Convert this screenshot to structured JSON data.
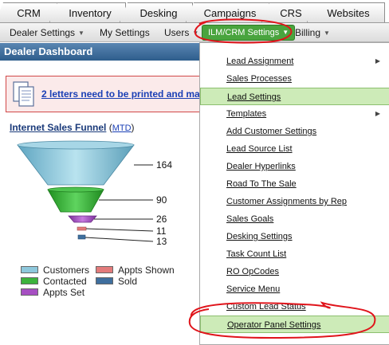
{
  "tabs": [
    {
      "label": "CRM"
    },
    {
      "label": "Inventory"
    },
    {
      "label": "Desking"
    },
    {
      "label": "Campaigns"
    },
    {
      "label": "CRS"
    },
    {
      "label": "Websites"
    }
  ],
  "subnav": {
    "dealer_settings": "Dealer Settings",
    "my_settings": "My Settings",
    "users": "Users",
    "ilm_crm_settings": "ILM/CRM Settings",
    "billing": "Billing"
  },
  "dashboard": {
    "title": "Dealer Dashboard",
    "alert_link": "2 letters need to be printed and mai"
  },
  "funnel": {
    "title": "Internet Sales Funnel",
    "period": "MTD",
    "values": {
      "customers": "164",
      "contacted": "90",
      "appts_set": "26",
      "appts_shown": "11",
      "sold": "13"
    },
    "colors": {
      "customers": "#8ec8dc",
      "contacted": "#3cb33c",
      "appts_set": "#a64fc2",
      "appts_shown": "#e37b7b",
      "sold": "#3f6f9e"
    }
  },
  "legend": {
    "customers": "Customers",
    "contacted": "Contacted",
    "appts_set": "Appts Set",
    "appts_shown": "Appts Shown",
    "sold": "Sold"
  },
  "menu": {
    "items": [
      {
        "label": "Lead Assignment",
        "has_submenu": true
      },
      {
        "label": "Sales Processes"
      },
      {
        "label": "Lead Settings",
        "highlighted": true
      },
      {
        "label": "Templates",
        "has_submenu": true
      },
      {
        "label": "Add Customer Settings"
      },
      {
        "label": "Lead Source List"
      },
      {
        "label": "Dealer Hyperlinks"
      },
      {
        "label": "Road To The Sale"
      },
      {
        "label": "Customer Assignments by Rep"
      },
      {
        "label": "Sales Goals"
      },
      {
        "label": "Desking Settings"
      },
      {
        "label": "Task Count List"
      },
      {
        "label": "RO OpCodes"
      },
      {
        "label": "Service Menu"
      },
      {
        "label": "Custom Lead Status"
      },
      {
        "label": "Operator Panel Settings",
        "highlighted": true
      }
    ]
  },
  "theme": {
    "active_green": "#49a43e",
    "annotation_red": "#e0141b",
    "header_blue": "#2e5d8c"
  }
}
